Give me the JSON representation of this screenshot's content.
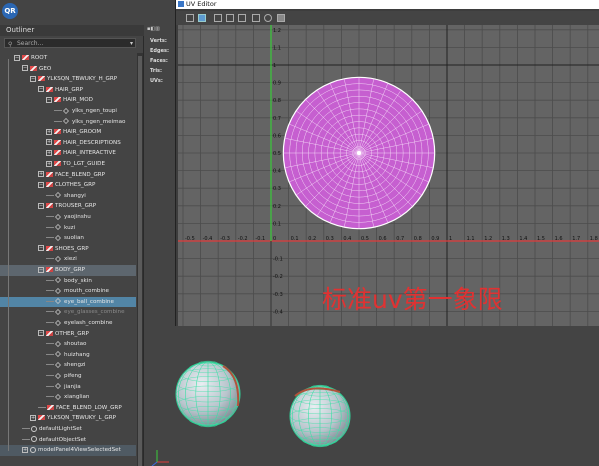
{
  "logo": {
    "text": "QR"
  },
  "outliner": {
    "title": "Outliner",
    "search_placeholder": "Search...",
    "items": [
      {
        "label": "ROOT",
        "depth": 0,
        "icon": "group-icon",
        "expander": "-",
        "state": "normal"
      },
      {
        "label": "GEO",
        "depth": 1,
        "icon": "group-icon",
        "expander": "-",
        "state": "normal"
      },
      {
        "label": "YLKSQN_TBWUKY_H_GRP",
        "depth": 2,
        "icon": "group-icon",
        "expander": "-",
        "state": "normal"
      },
      {
        "label": "HAIR_GRP",
        "depth": 3,
        "icon": "group-icon",
        "expander": "-",
        "state": "normal"
      },
      {
        "label": "HAIR_MOD",
        "depth": 4,
        "icon": "group-icon",
        "expander": "-",
        "state": "normal"
      },
      {
        "label": "ylks_ngen_toupi",
        "depth": 5,
        "icon": "mesh-icon",
        "expander": "",
        "state": "normal"
      },
      {
        "label": "ylks_ngen_meimao",
        "depth": 5,
        "icon": "mesh-icon",
        "expander": "",
        "state": "normal"
      },
      {
        "label": "HAIR_GROOM",
        "depth": 4,
        "icon": "group-icon",
        "expander": "+",
        "state": "normal"
      },
      {
        "label": "HAIR_DESCRIPTIONS",
        "depth": 4,
        "icon": "group-icon",
        "expander": "+",
        "state": "normal"
      },
      {
        "label": "HAIR_INTERACTIVE",
        "depth": 4,
        "icon": "group-icon",
        "expander": "+",
        "state": "normal"
      },
      {
        "label": "TO_LGT_GUIDE",
        "depth": 4,
        "icon": "group-icon",
        "expander": "+",
        "state": "normal"
      },
      {
        "label": "FACE_BLEND_GRP",
        "depth": 3,
        "icon": "group-icon",
        "expander": "+",
        "state": "normal"
      },
      {
        "label": "CLOTHES_GRP",
        "depth": 3,
        "icon": "group-icon",
        "expander": "-",
        "state": "normal"
      },
      {
        "label": "shangyi",
        "depth": 4,
        "icon": "mesh-icon",
        "expander": "",
        "state": "normal"
      },
      {
        "label": "TROUSER_GRP",
        "depth": 3,
        "icon": "group-icon",
        "expander": "-",
        "state": "normal"
      },
      {
        "label": "yaojinshu",
        "depth": 4,
        "icon": "mesh-icon",
        "expander": "",
        "state": "normal"
      },
      {
        "label": "kuzi",
        "depth": 4,
        "icon": "mesh-icon",
        "expander": "",
        "state": "normal"
      },
      {
        "label": "suolian",
        "depth": 4,
        "icon": "mesh-icon",
        "expander": "",
        "state": "normal"
      },
      {
        "label": "SHOES_GRP",
        "depth": 3,
        "icon": "group-icon",
        "expander": "-",
        "state": "normal"
      },
      {
        "label": "xiezi",
        "depth": 4,
        "icon": "mesh-icon",
        "expander": "",
        "state": "normal"
      },
      {
        "label": "BODY_GRP",
        "depth": 3,
        "icon": "group-icon",
        "expander": "-",
        "state": "highlight"
      },
      {
        "label": "body_skin",
        "depth": 4,
        "icon": "mesh-icon",
        "expander": "",
        "state": "normal"
      },
      {
        "label": "mouth_combine",
        "depth": 4,
        "icon": "mesh-icon",
        "expander": "",
        "state": "normal"
      },
      {
        "label": "eye_ball_combine",
        "depth": 4,
        "icon": "mesh-icon",
        "expander": "",
        "state": "selected"
      },
      {
        "label": "eye_glasses_combine",
        "depth": 4,
        "icon": "mesh-icon",
        "expander": "",
        "state": "dim"
      },
      {
        "label": "eyelash_combine",
        "depth": 4,
        "icon": "mesh-icon",
        "expander": "",
        "state": "normal"
      },
      {
        "label": "OTHER_GRP",
        "depth": 3,
        "icon": "group-icon",
        "expander": "-",
        "state": "normal"
      },
      {
        "label": "shoutao",
        "depth": 4,
        "icon": "mesh-icon",
        "expander": "",
        "state": "normal"
      },
      {
        "label": "huizhang",
        "depth": 4,
        "icon": "mesh-icon",
        "expander": "",
        "state": "normal"
      },
      {
        "label": "shengzi",
        "depth": 4,
        "icon": "mesh-icon",
        "expander": "",
        "state": "normal"
      },
      {
        "label": "pifeng",
        "depth": 4,
        "icon": "mesh-icon",
        "expander": "",
        "state": "normal"
      },
      {
        "label": "jianjia",
        "depth": 4,
        "icon": "mesh-icon",
        "expander": "",
        "state": "normal"
      },
      {
        "label": "xianglian",
        "depth": 4,
        "icon": "mesh-icon",
        "expander": "",
        "state": "normal"
      },
      {
        "label": "FACE_BLEND_LOW_GRP",
        "depth": 3,
        "icon": "group-icon",
        "expander": "",
        "state": "normal"
      },
      {
        "label": "YLKSQN_TBWUKY_L_GRP",
        "depth": 2,
        "icon": "group-icon",
        "expander": "+",
        "state": "normal"
      },
      {
        "label": "defaultLightSet",
        "depth": 1,
        "icon": "set-icon",
        "expander": "",
        "state": "normal"
      },
      {
        "label": "defaultObjectSet",
        "depth": 1,
        "icon": "set-icon",
        "expander": "",
        "state": "normal"
      },
      {
        "label": "modelPanel4ViewSelectedSet",
        "depth": 1,
        "icon": "set-icon",
        "expander": "+",
        "state": "dim2"
      }
    ]
  },
  "hud": {
    "verts": "Verts:",
    "edges": "Edges:",
    "faces": "Faces:",
    "tris": "Tris:",
    "uvs": "UVs:"
  },
  "uv_editor": {
    "title": "UV Editor",
    "x_ticks": [
      "-1",
      "-0.9",
      "-0.8",
      "-0.7",
      "-0.6",
      "-0.5",
      "-0.4",
      "-0.3",
      "-0.2",
      "-0.1",
      "0",
      "0.1",
      "0.2",
      "0.3",
      "0.4",
      "0.5",
      "0.6",
      "0.7",
      "0.8",
      "0.9",
      "1",
      "1.1",
      "1.2",
      "1.3",
      "1.4",
      "1.5",
      "1.6",
      "1.7",
      "1.8"
    ],
    "y_ticks": [
      "1.2",
      "1.1",
      "1",
      "0.9",
      "0.8",
      "0.7",
      "0.6",
      "0.5",
      "0.4",
      "0.3",
      "0.2",
      "0.1",
      "-0.1",
      "-0.2",
      "-0.3",
      "-0.4",
      "-0.5"
    ],
    "uv_shell_center": [
      0.5,
      0.5
    ],
    "uv_shell_radius": 0.43,
    "shell_color": "#c65fd0",
    "annotation": "标准uv第一象限"
  },
  "colors": {
    "x_axis": "#e13b3b",
    "y_axis": "#3acb3a",
    "accent": "#5285a6",
    "annotation": "#e03232"
  }
}
